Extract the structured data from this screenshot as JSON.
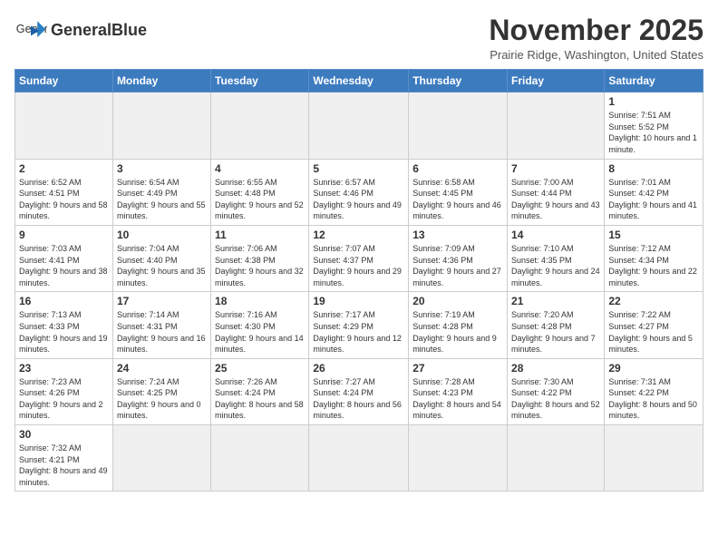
{
  "header": {
    "logo_text_regular": "General",
    "logo_text_bold": "Blue",
    "month_title": "November 2025",
    "location": "Prairie Ridge, Washington, United States"
  },
  "weekdays": [
    "Sunday",
    "Monday",
    "Tuesday",
    "Wednesday",
    "Thursday",
    "Friday",
    "Saturday"
  ],
  "weeks": [
    [
      {
        "day": "",
        "info": ""
      },
      {
        "day": "",
        "info": ""
      },
      {
        "day": "",
        "info": ""
      },
      {
        "day": "",
        "info": ""
      },
      {
        "day": "",
        "info": ""
      },
      {
        "day": "",
        "info": ""
      },
      {
        "day": "1",
        "info": "Sunrise: 7:51 AM\nSunset: 5:52 PM\nDaylight: 10 hours and 1 minute."
      }
    ],
    [
      {
        "day": "2",
        "info": "Sunrise: 6:52 AM\nSunset: 4:51 PM\nDaylight: 9 hours and 58 minutes."
      },
      {
        "day": "3",
        "info": "Sunrise: 6:54 AM\nSunset: 4:49 PM\nDaylight: 9 hours and 55 minutes."
      },
      {
        "day": "4",
        "info": "Sunrise: 6:55 AM\nSunset: 4:48 PM\nDaylight: 9 hours and 52 minutes."
      },
      {
        "day": "5",
        "info": "Sunrise: 6:57 AM\nSunset: 4:46 PM\nDaylight: 9 hours and 49 minutes."
      },
      {
        "day": "6",
        "info": "Sunrise: 6:58 AM\nSunset: 4:45 PM\nDaylight: 9 hours and 46 minutes."
      },
      {
        "day": "7",
        "info": "Sunrise: 7:00 AM\nSunset: 4:44 PM\nDaylight: 9 hours and 43 minutes."
      },
      {
        "day": "8",
        "info": "Sunrise: 7:01 AM\nSunset: 4:42 PM\nDaylight: 9 hours and 41 minutes."
      }
    ],
    [
      {
        "day": "9",
        "info": "Sunrise: 7:03 AM\nSunset: 4:41 PM\nDaylight: 9 hours and 38 minutes."
      },
      {
        "day": "10",
        "info": "Sunrise: 7:04 AM\nSunset: 4:40 PM\nDaylight: 9 hours and 35 minutes."
      },
      {
        "day": "11",
        "info": "Sunrise: 7:06 AM\nSunset: 4:38 PM\nDaylight: 9 hours and 32 minutes."
      },
      {
        "day": "12",
        "info": "Sunrise: 7:07 AM\nSunset: 4:37 PM\nDaylight: 9 hours and 29 minutes."
      },
      {
        "day": "13",
        "info": "Sunrise: 7:09 AM\nSunset: 4:36 PM\nDaylight: 9 hours and 27 minutes."
      },
      {
        "day": "14",
        "info": "Sunrise: 7:10 AM\nSunset: 4:35 PM\nDaylight: 9 hours and 24 minutes."
      },
      {
        "day": "15",
        "info": "Sunrise: 7:12 AM\nSunset: 4:34 PM\nDaylight: 9 hours and 22 minutes."
      }
    ],
    [
      {
        "day": "16",
        "info": "Sunrise: 7:13 AM\nSunset: 4:33 PM\nDaylight: 9 hours and 19 minutes."
      },
      {
        "day": "17",
        "info": "Sunrise: 7:14 AM\nSunset: 4:31 PM\nDaylight: 9 hours and 16 minutes."
      },
      {
        "day": "18",
        "info": "Sunrise: 7:16 AM\nSunset: 4:30 PM\nDaylight: 9 hours and 14 minutes."
      },
      {
        "day": "19",
        "info": "Sunrise: 7:17 AM\nSunset: 4:29 PM\nDaylight: 9 hours and 12 minutes."
      },
      {
        "day": "20",
        "info": "Sunrise: 7:19 AM\nSunset: 4:28 PM\nDaylight: 9 hours and 9 minutes."
      },
      {
        "day": "21",
        "info": "Sunrise: 7:20 AM\nSunset: 4:28 PM\nDaylight: 9 hours and 7 minutes."
      },
      {
        "day": "22",
        "info": "Sunrise: 7:22 AM\nSunset: 4:27 PM\nDaylight: 9 hours and 5 minutes."
      }
    ],
    [
      {
        "day": "23",
        "info": "Sunrise: 7:23 AM\nSunset: 4:26 PM\nDaylight: 9 hours and 2 minutes."
      },
      {
        "day": "24",
        "info": "Sunrise: 7:24 AM\nSunset: 4:25 PM\nDaylight: 9 hours and 0 minutes."
      },
      {
        "day": "25",
        "info": "Sunrise: 7:26 AM\nSunset: 4:24 PM\nDaylight: 8 hours and 58 minutes."
      },
      {
        "day": "26",
        "info": "Sunrise: 7:27 AM\nSunset: 4:24 PM\nDaylight: 8 hours and 56 minutes."
      },
      {
        "day": "27",
        "info": "Sunrise: 7:28 AM\nSunset: 4:23 PM\nDaylight: 8 hours and 54 minutes."
      },
      {
        "day": "28",
        "info": "Sunrise: 7:30 AM\nSunset: 4:22 PM\nDaylight: 8 hours and 52 minutes."
      },
      {
        "day": "29",
        "info": "Sunrise: 7:31 AM\nSunset: 4:22 PM\nDaylight: 8 hours and 50 minutes."
      }
    ],
    [
      {
        "day": "30",
        "info": "Sunrise: 7:32 AM\nSunset: 4:21 PM\nDaylight: 8 hours and 49 minutes."
      },
      {
        "day": "",
        "info": ""
      },
      {
        "day": "",
        "info": ""
      },
      {
        "day": "",
        "info": ""
      },
      {
        "day": "",
        "info": ""
      },
      {
        "day": "",
        "info": ""
      },
      {
        "day": "",
        "info": ""
      }
    ]
  ]
}
